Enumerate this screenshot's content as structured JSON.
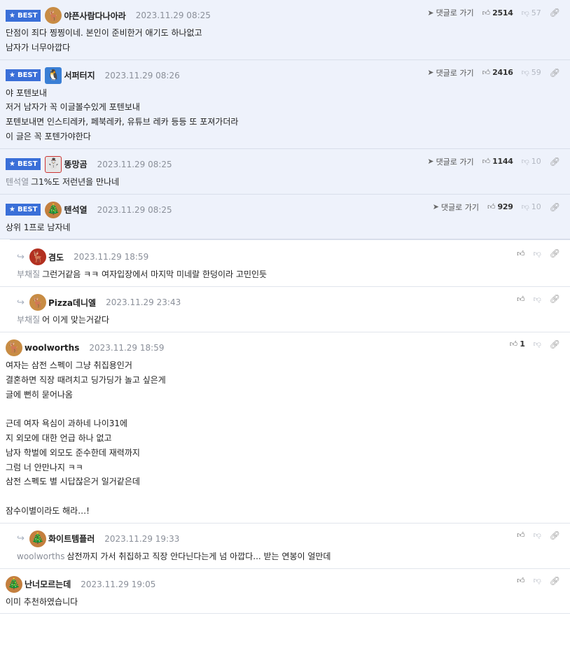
{
  "ui": {
    "best_label": "BEST",
    "goto_label": "댓글로 가기"
  },
  "comments": [
    {
      "best": true,
      "nick": "야픈사람다나아라",
      "date": "2023.11.29 08:25",
      "likes": "2514",
      "dislikes": "57",
      "lines": [
        "단점이 죄다 찡찡이네. 본인이 준비한거 애기도 하나없고",
        "남자가 너무아깝다"
      ]
    },
    {
      "best": true,
      "nick": "서퍼터지",
      "date": "2023.11.29 08:26",
      "likes": "2416",
      "dislikes": "59",
      "lines": [
        "야 포텐보내",
        "저거 남자가 꼭 이글볼수있게 포텐보내",
        "포텐보내면 인스티레카, 페북레카, 유튜브 레카 등등 또 포져가더라",
        "이 글은 꼭 포텐가야한다"
      ]
    },
    {
      "best": true,
      "nick": "똥망곰",
      "date": "2023.11.29 08:25",
      "likes": "1144",
      "dislikes": "10",
      "mention": "텐석열",
      "lines": [
        "그1%도 저런년을 만나네"
      ]
    },
    {
      "best": true,
      "nick": "텐석열",
      "date": "2023.11.29 08:25",
      "likes": "929",
      "dislikes": "10",
      "lines": [
        "상위 1프로 남자네"
      ]
    },
    {
      "reply": true,
      "nick": "겸도",
      "date": "2023.11.29 18:59",
      "mention": "부채질",
      "lines": [
        "그런거같음 ㅋㅋ 여자입장에서 마지막 미네랄 한덩이라 고민인듯"
      ]
    },
    {
      "reply": true,
      "nick": "Pizza데니엘",
      "date": "2023.11.29 23:43",
      "mention": "부채질",
      "lines": [
        "어 이게 맞는거같다"
      ]
    },
    {
      "nick": "woolworths",
      "date": "2023.11.29 18:59",
      "likes": "1",
      "lines": [
        "여자는 삼전 스펙이 그냥 취집용인거",
        "결혼하면 직장 때려치고 딩가딩가 놀고 싶은게",
        "글에 뻔히 묻어나옴",
        "",
        "근데 여자 욕심이 과하네 나이31에",
        "지 외모에 대한 언급 하나 없고",
        "남자 학벌에 외모도 준수한데 재력까지",
        "그럼 너 안만나지 ㅋㅋ",
        "삼전 스펙도 별 시답잖은거 일거같은데",
        "",
        "잠수이별이라도 해라…!"
      ]
    },
    {
      "reply": true,
      "nick": "화이트템플러",
      "date": "2023.11.29 19:33",
      "mention": "woolworths",
      "lines": [
        "삼전까지 가서 취집하고 직장 안다닌다는게 넘 아깝다... 받는 연봉이 얼만데"
      ]
    },
    {
      "nick": "난너모르는데",
      "date": "2023.11.29 19:05",
      "lines": [
        "이미 추천하였습니다"
      ]
    }
  ],
  "avatars": [
    "deer",
    "box",
    "snow",
    "hat",
    "red",
    "deer",
    "deer",
    "hat",
    "hat"
  ]
}
